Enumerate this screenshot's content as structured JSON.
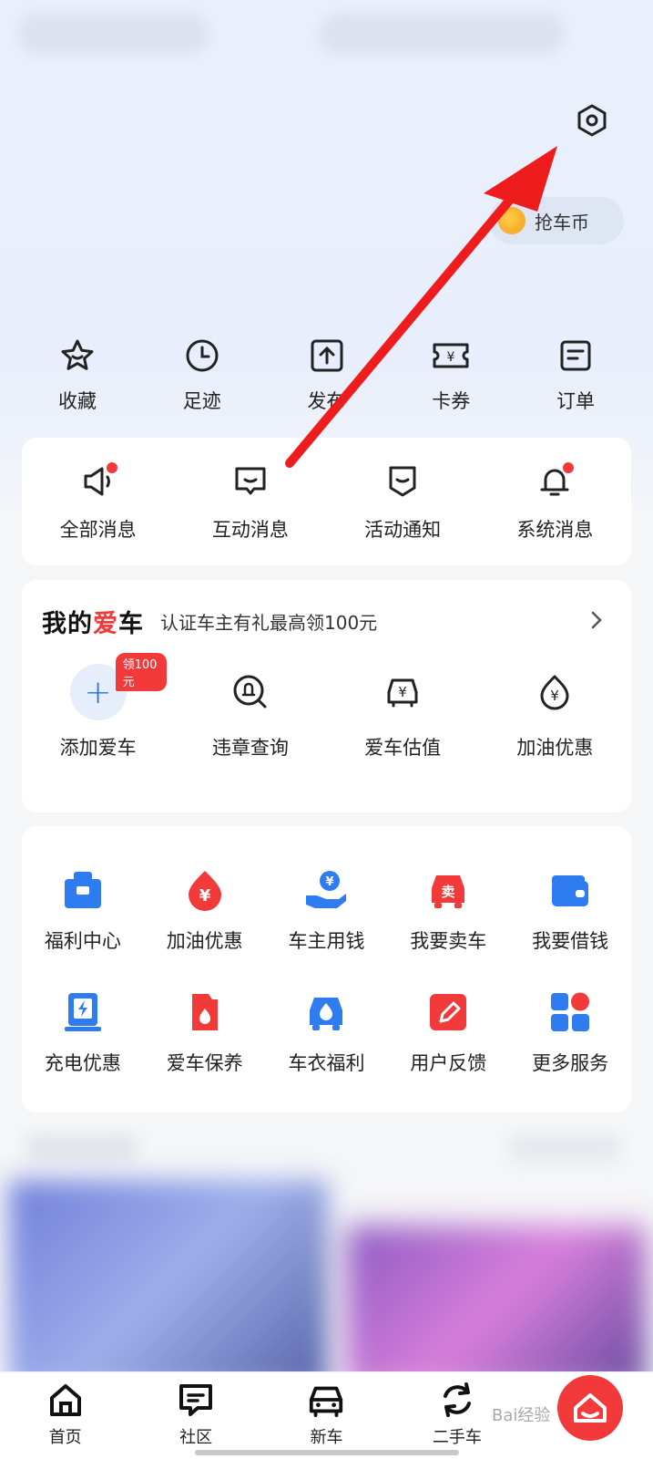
{
  "header": {
    "coin_label": "抢车币"
  },
  "quick_actions": [
    {
      "label": "收藏",
      "icon": "star-icon"
    },
    {
      "label": "足迹",
      "icon": "clock-icon"
    },
    {
      "label": "发布",
      "icon": "upload-icon"
    },
    {
      "label": "卡券",
      "icon": "ticket-icon"
    },
    {
      "label": "订单",
      "icon": "order-icon"
    }
  ],
  "messages": [
    {
      "label": "全部消息",
      "icon": "megaphone-icon",
      "dot": true
    },
    {
      "label": "互动消息",
      "icon": "chat-icon",
      "dot": false
    },
    {
      "label": "活动通知",
      "icon": "activity-icon",
      "dot": false
    },
    {
      "label": "系统消息",
      "icon": "bell-icon",
      "dot": true
    }
  ],
  "my_car": {
    "title_prefix": "我的",
    "title_heart": "爱",
    "title_suffix": "车",
    "subtitle": "认证车主有礼最高领100元",
    "badge": "领100元",
    "items": [
      {
        "label": "添加爱车",
        "icon": "plus-icon"
      },
      {
        "label": "违章查询",
        "icon": "violation-search-icon"
      },
      {
        "label": "爱车估值",
        "icon": "car-valuation-icon"
      },
      {
        "label": "加油优惠",
        "icon": "fuel-discount-icon"
      }
    ]
  },
  "services": [
    {
      "label": "福利中心",
      "icon": "gift-icon"
    },
    {
      "label": "加油优惠",
      "icon": "fuel-drop-icon"
    },
    {
      "label": "车主用钱",
      "icon": "money-hand-icon"
    },
    {
      "label": "我要卖车",
      "icon": "sell-car-icon"
    },
    {
      "label": "我要借钱",
      "icon": "wallet-icon"
    },
    {
      "label": "充电优惠",
      "icon": "charging-icon"
    },
    {
      "label": "爱车保养",
      "icon": "oil-can-icon"
    },
    {
      "label": "车衣福利",
      "icon": "car-wash-icon"
    },
    {
      "label": "用户反馈",
      "icon": "feedback-icon"
    },
    {
      "label": "更多服务",
      "icon": "more-services-icon"
    }
  ],
  "tabbar": [
    {
      "label": "首页",
      "icon": "home-icon"
    },
    {
      "label": "社区",
      "icon": "community-icon"
    },
    {
      "label": "新车",
      "icon": "new-car-icon"
    },
    {
      "label": "二手车",
      "icon": "used-car-icon"
    }
  ],
  "watermark": "Bai经验",
  "colors": {
    "accent": "#1f6fe9",
    "red": "#f23a3a",
    "annotation_arrow": "#ee1c1c"
  }
}
